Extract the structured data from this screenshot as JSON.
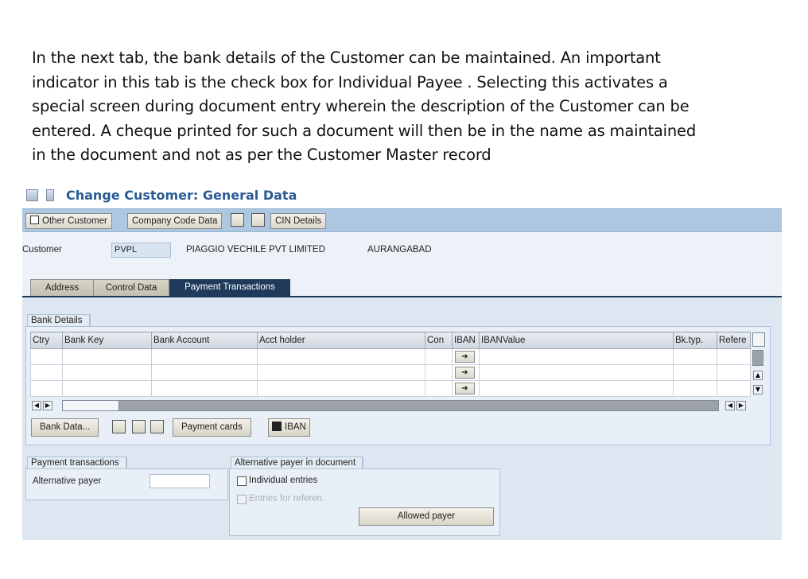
{
  "intro": {
    "line1": "In the next tab, the bank details of the Customer can be maintained. An important",
    "line2": "indicator in this tab is the check box for Individual Payee . Selecting this activates a",
    "line3": "special screen during document entry wherein the description of the Customer can be",
    "line4": "entered. A cheque printed for such a document will then be in the name as maintained",
    "line5": "in the document and not as per the Customer Master record"
  },
  "window": {
    "title": "Change Customer: General Data"
  },
  "toolbar": {
    "other_customer": "Other Customer",
    "company_code_data": "Company Code Data",
    "cin_details": "CIN Details"
  },
  "header": {
    "customer_label": "Customer",
    "customer_value": "PVPL",
    "customer_name": "PIAGGIO VECHILE PVT LIMITED",
    "city": "AURANGABAD"
  },
  "tabs": [
    {
      "label": "Address",
      "active": false
    },
    {
      "label": "Control Data",
      "active": false
    },
    {
      "label": "Payment Transactions",
      "active": true
    }
  ],
  "bank_details": {
    "group_title": "Bank Details",
    "columns": [
      "Ctry",
      "Bank Key",
      "Bank Account",
      "Acct holder",
      "Con",
      "IBAN",
      "IBANValue",
      "Bk.typ.",
      "Refere"
    ],
    "rows": [
      [
        "",
        "",
        "",
        "",
        "",
        "",
        "",
        "",
        ""
      ],
      [
        "",
        "",
        "",
        "",
        "",
        "",
        "",
        "",
        ""
      ],
      [
        "",
        "",
        "",
        "",
        "",
        "",
        "",
        "",
        ""
      ]
    ],
    "bank_data_button": "Bank Data...",
    "payment_cards_button": "Payment cards",
    "iban_button": "IBAN"
  },
  "payment_transactions": {
    "group_title": "Payment transactions",
    "alternative_payer_label": "Alternative payer",
    "alternative_payer_value": ""
  },
  "alternative_payer_doc": {
    "group_title": "Alternative payer in document",
    "individual_entries": "Individual entries",
    "individual_entries_checked": false,
    "entries_for_referen": "Entries for referen.",
    "allowed_payer_button": "Allowed payer"
  },
  "colors": {
    "title_blue": "#2a5b93",
    "toolbar_blue": "#adc7e1",
    "active_tab": "#1f3a5a",
    "panel_bg": "#dde7f1"
  }
}
